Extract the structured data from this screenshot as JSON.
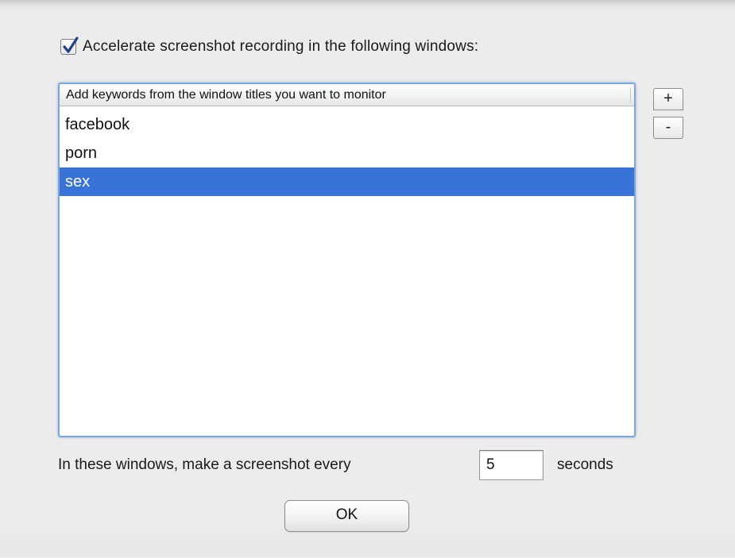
{
  "dialog": {
    "accelerate_checkbox": {
      "checked": true,
      "label": "Accelerate screenshot recording in the following windows:"
    },
    "keywords_list": {
      "header": "Add keywords from the window titles you want to monitor",
      "items": [
        "facebook",
        "porn",
        "sex"
      ],
      "selected_index": 2,
      "selection_color": "#3874d8"
    },
    "add_button_label": "+",
    "remove_button_label": "-",
    "interval": {
      "prefix": "In these windows, make a screenshot every",
      "value": "5",
      "suffix": "seconds"
    },
    "ok_label": "OK"
  }
}
